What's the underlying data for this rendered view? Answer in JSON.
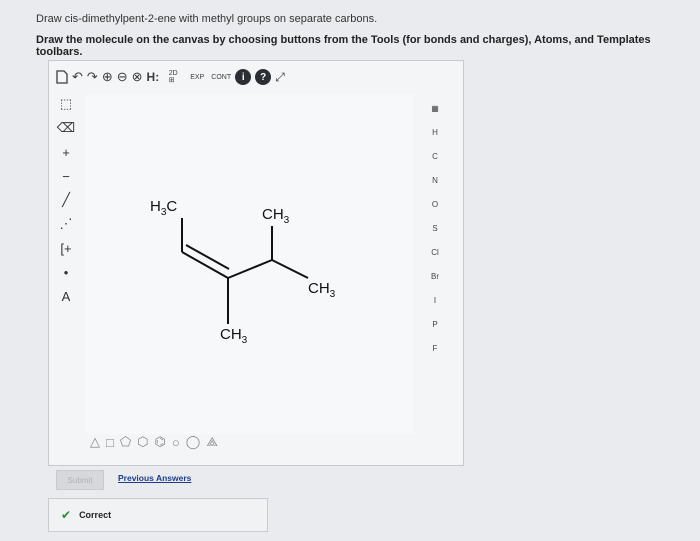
{
  "question": {
    "line1": "Draw cis-dimethylpent-2-ene with methyl groups on separate carbons.",
    "line2": "Draw the molecule on the canvas by choosing buttons from the Tools (for bonds and charges), Atoms, and Templates toolbars."
  },
  "toolbar_top": {
    "h_label": "H:",
    "exp_label": "EXP",
    "cont_label": "CONT",
    "info_label": "i",
    "help_label": "?"
  },
  "toolbar_left": {
    "plus": "+",
    "minus": "−",
    "charge_label": "A"
  },
  "atoms": [
    "H",
    "C",
    "N",
    "O",
    "S",
    "Cl",
    "Br",
    "I",
    "P",
    "F"
  ],
  "molecule": {
    "labels": [
      {
        "base": "H",
        "sub": "3",
        "tail": "C"
      },
      {
        "base": "CH",
        "sub": "3",
        "tail": ""
      },
      {
        "base": "CH",
        "sub": "3",
        "tail": ""
      },
      {
        "base": "CH",
        "sub": "3",
        "tail": ""
      }
    ]
  },
  "actions": {
    "submit_label": "Submit",
    "previous_answers_label": "Previous Answers"
  },
  "status": {
    "text": "Correct",
    "color": "#2e8b3a"
  }
}
